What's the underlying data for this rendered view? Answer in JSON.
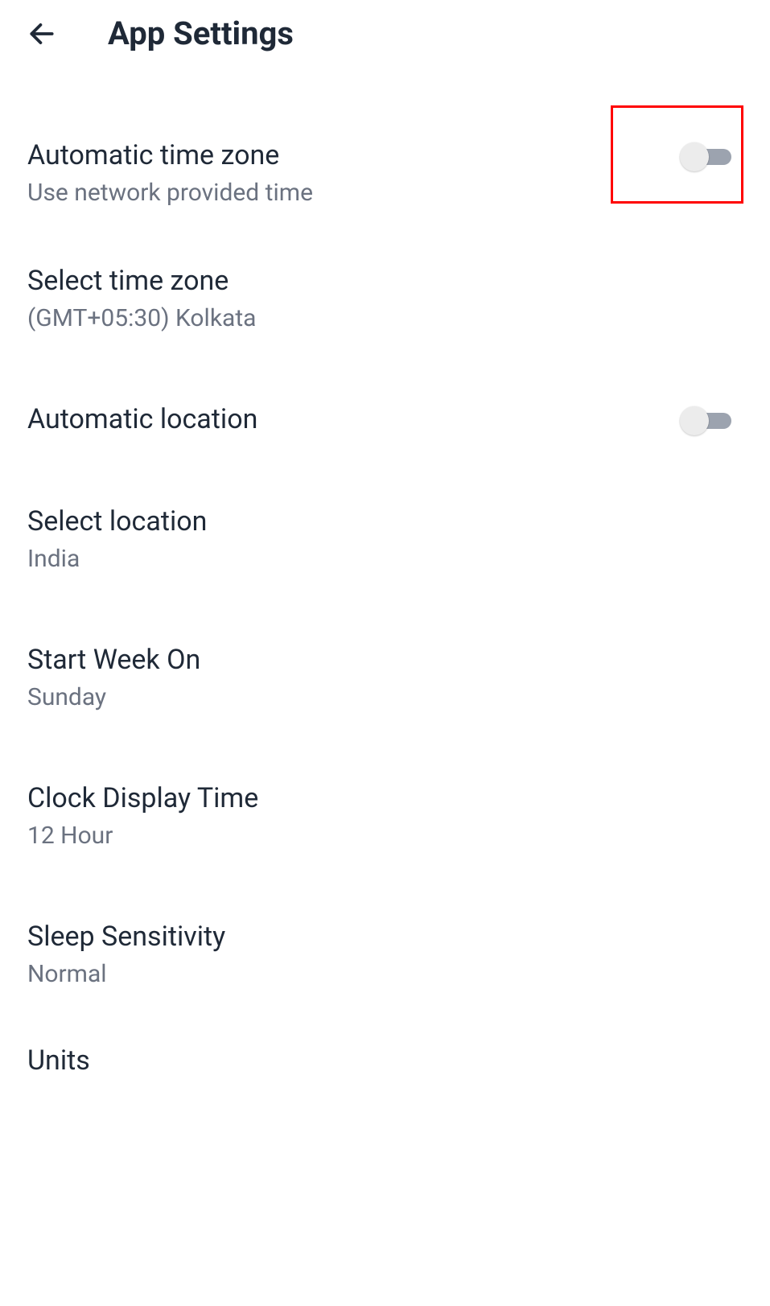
{
  "header": {
    "title": "App Settings"
  },
  "settings": {
    "autoTimeZone": {
      "label": "Automatic time zone",
      "sublabel": "Use network provided time"
    },
    "selectTimeZone": {
      "label": "Select time zone",
      "sublabel": "(GMT+05:30) Kolkata"
    },
    "autoLocation": {
      "label": "Automatic location"
    },
    "selectLocation": {
      "label": "Select location",
      "sublabel": "India"
    },
    "startWeek": {
      "label": "Start Week On",
      "sublabel": "Sunday"
    },
    "clockDisplay": {
      "label": "Clock Display Time",
      "sublabel": "12 Hour"
    },
    "sleepSensitivity": {
      "label": "Sleep Sensitivity",
      "sublabel": "Normal"
    },
    "units": {
      "label": "Units"
    }
  }
}
